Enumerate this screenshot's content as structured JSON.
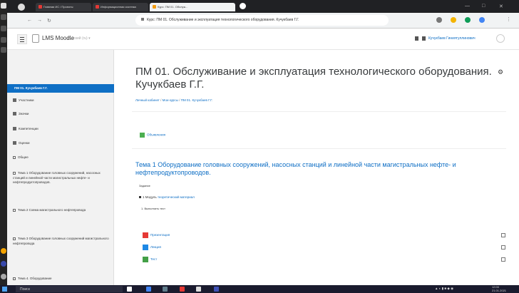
{
  "browser": {
    "tabs": [
      {
        "label": "Главная ИС / Проекты"
      },
      {
        "label": "Информационная система"
      },
      {
        "label": "Курс: ПМ 01. Обслуж..."
      }
    ],
    "url": "Курс: ПМ 01. Обслуживание и эксплуатация технологического оборудования. Кучукбаев Г.Г."
  },
  "moodle": {
    "site_name": "LMS Moodle",
    "language": "Русский (ru) ▾",
    "user_name": "Кучукбаев Гиниятуллинович"
  },
  "drawer": {
    "current_course": "ПМ 01. Кучукбаев Г.Г.",
    "items": [
      {
        "label": "Участники",
        "icon": "users-icon"
      },
      {
        "label": "Значки",
        "icon": "badge-icon"
      },
      {
        "label": "Компетенции",
        "icon": "competency-icon"
      },
      {
        "label": "Оценки",
        "icon": "grades-icon"
      },
      {
        "label": "Общее",
        "icon": "folder-icon"
      }
    ],
    "sections": [
      {
        "label": "Тема 1 Оборудование головных сооружений, насосных станций и линейной части магистральных нефте- и нефтепродуктопроводов."
      },
      {
        "label": "Тема 2 Схема магистрального нефтепровода"
      },
      {
        "label": "Тема 3 Оборудование головных сооружений магистрального нефтепровода"
      },
      {
        "label": "Тема 4. Оборудование"
      }
    ]
  },
  "course": {
    "title": "ПМ 01. Обслуживание и эксплуатация технологического оборудования. Кучукбаев Г.Г.",
    "breadcrumb": [
      "Личный кабинет",
      "Мои курсы",
      "ПМ 01. Кучукбаев Г.Г."
    ],
    "news": "Объявления",
    "topic_title": "Тема 1 Оборудование головных сооружений, насосных станций и линейной части магистральных нефте- и нефтепродуктопроводов.",
    "summary_heading": "Задание",
    "module_label": "1 Модуль",
    "module_link": "теоретический материал",
    "subtask": "1. Выполнить тест",
    "activities": [
      {
        "label": "Презентация",
        "icon": "presentation-icon",
        "color": "#e53935"
      },
      {
        "label": "Лекция",
        "icon": "lecture-icon",
        "color": "#1e88e5"
      },
      {
        "label": "Тест",
        "icon": "quiz-icon",
        "color": "#43a047"
      }
    ]
  },
  "taskbar": {
    "search_placeholder": "Поиск",
    "time": "12:00",
    "date": "21.01.2021"
  }
}
